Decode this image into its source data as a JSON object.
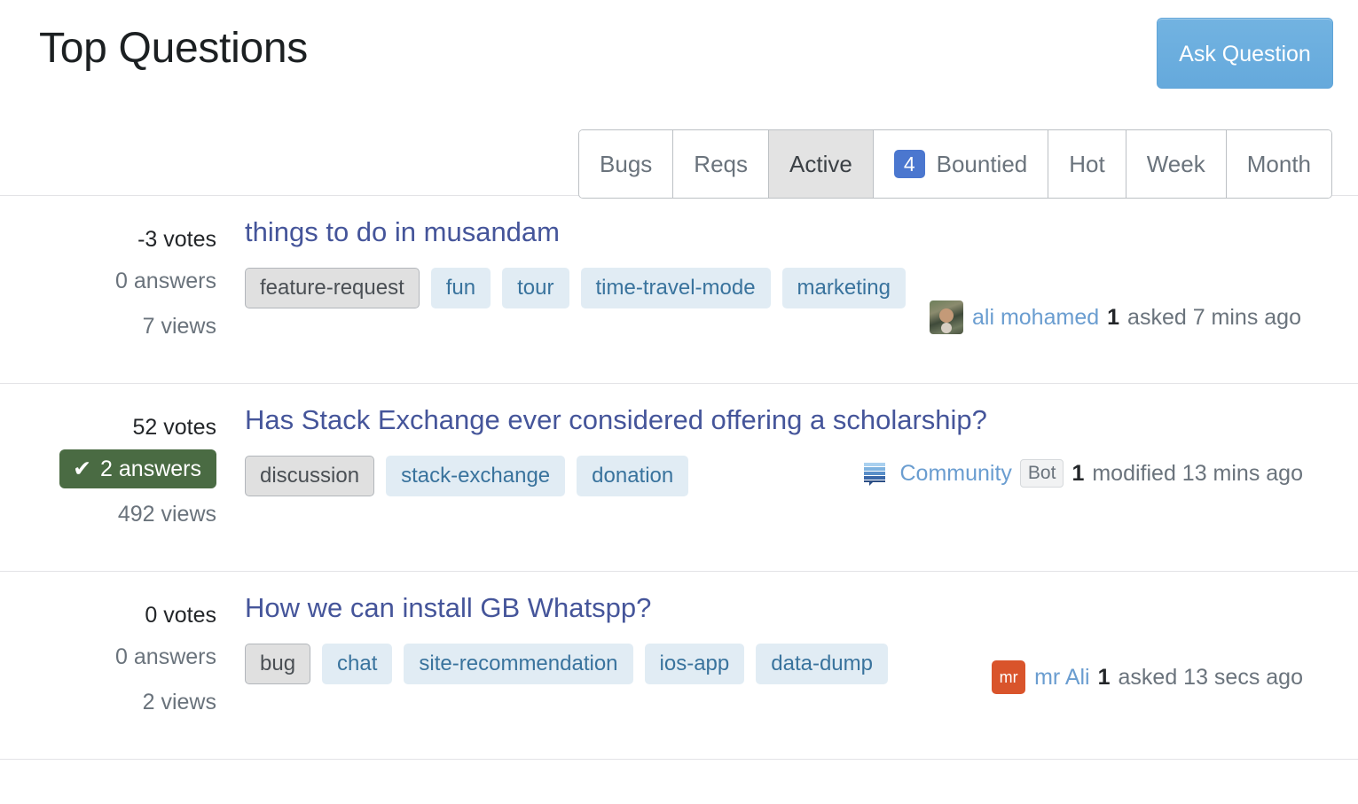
{
  "header": {
    "title": "Top Questions",
    "ask_button_label": "Ask Question"
  },
  "tabs": [
    {
      "label": "Bugs",
      "selected": false,
      "badge": null
    },
    {
      "label": "Reqs",
      "selected": false,
      "badge": null
    },
    {
      "label": "Active",
      "selected": true,
      "badge": null
    },
    {
      "label": "Bountied",
      "selected": false,
      "badge": "4"
    },
    {
      "label": "Hot",
      "selected": false,
      "badge": null
    },
    {
      "label": "Week",
      "selected": false,
      "badge": null
    },
    {
      "label": "Month",
      "selected": false,
      "badge": null
    }
  ],
  "questions": [
    {
      "votes": "-3 votes",
      "answers": "0 answers",
      "answered": false,
      "views": "7 views",
      "title": "things to do in musandam",
      "tags": [
        {
          "label": "feature-request",
          "required": true
        },
        {
          "label": "fun",
          "required": false
        },
        {
          "label": "tour",
          "required": false
        },
        {
          "label": "time-travel-mode",
          "required": false
        },
        {
          "label": "marketing",
          "required": false
        }
      ],
      "user": {
        "avatar_type": "photo",
        "avatar_initials": "",
        "name": "ali mohamed",
        "bot": null,
        "reputation": "1",
        "action": "asked 7 mins ago"
      }
    },
    {
      "votes": "52 votes",
      "answers": "2 answers",
      "answered": true,
      "views": "492 views",
      "title": "Has Stack Exchange ever considered offering a scholarship?",
      "tags": [
        {
          "label": "discussion",
          "required": true
        },
        {
          "label": "stack-exchange",
          "required": false
        },
        {
          "label": "donation",
          "required": false
        }
      ],
      "user": {
        "avatar_type": "bubble",
        "avatar_initials": "",
        "name": "Community",
        "bot": "Bot",
        "reputation": "1",
        "action": "modified 13 mins ago"
      }
    },
    {
      "votes": "0 votes",
      "answers": "0 answers",
      "answered": false,
      "views": "2 views",
      "title": "How we can install GB Whatspp?",
      "tags": [
        {
          "label": "bug",
          "required": true
        },
        {
          "label": "chat",
          "required": false
        },
        {
          "label": "site-recommendation",
          "required": false
        },
        {
          "label": "ios-app",
          "required": false
        },
        {
          "label": "data-dump",
          "required": false
        }
      ],
      "user": {
        "avatar_type": "initials",
        "avatar_initials": "mr",
        "name": "mr Ali",
        "bot": null,
        "reputation": "1",
        "action": "asked 13 secs ago"
      }
    }
  ],
  "icons": {
    "check": "✔",
    "community_bubble": "community-bubble-icon"
  },
  "colors": {
    "accent_blue": "#6aaedf",
    "tag_blue_bg": "#e1ecf4",
    "tag_blue_text": "#39739d",
    "answered_green": "#4a6b43",
    "badge_blue": "#4b77cf",
    "title_link": "#45559a",
    "avatar_orange": "#d9542b"
  }
}
